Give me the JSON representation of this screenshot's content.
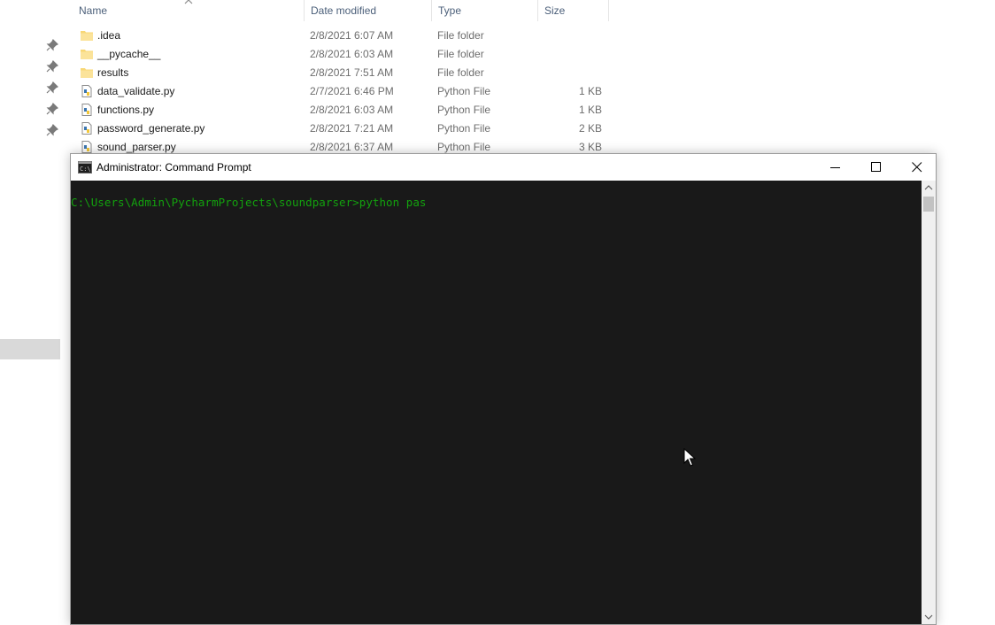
{
  "explorer": {
    "columns": {
      "name": "Name",
      "date": "Date modified",
      "type": "Type",
      "size": "Size"
    },
    "files": [
      {
        "name": ".idea",
        "date": "2/8/2021 6:07 AM",
        "type": "File folder",
        "size": "",
        "icon": "folder-icon"
      },
      {
        "name": "__pycache__",
        "date": "2/8/2021 6:03 AM",
        "type": "File folder",
        "size": "",
        "icon": "folder-icon"
      },
      {
        "name": "results",
        "date": "2/8/2021 7:51 AM",
        "type": "File folder",
        "size": "",
        "icon": "folder-icon"
      },
      {
        "name": "data_validate.py",
        "date": "2/7/2021 6:46 PM",
        "type": "Python File",
        "size": "1 KB",
        "icon": "python-file-icon"
      },
      {
        "name": "functions.py",
        "date": "2/8/2021 6:03 AM",
        "type": "Python File",
        "size": "1 KB",
        "icon": "python-file-icon"
      },
      {
        "name": "password_generate.py",
        "date": "2/8/2021 7:21 AM",
        "type": "Python File",
        "size": "2 KB",
        "icon": "python-file-icon"
      },
      {
        "name": "sound_parser.py",
        "date": "2/8/2021 6:37 AM",
        "type": "Python File",
        "size": "3 KB",
        "icon": "python-file-icon"
      }
    ]
  },
  "cmd": {
    "title": "Administrator: Command Prompt",
    "line": "C:\\Users\\Admin\\PycharmProjects\\soundparser>python pas",
    "text_color": "#13a10e",
    "background": "#191919"
  },
  "colors": {
    "folder": "#f8d775",
    "header_text": "#4c607a"
  }
}
